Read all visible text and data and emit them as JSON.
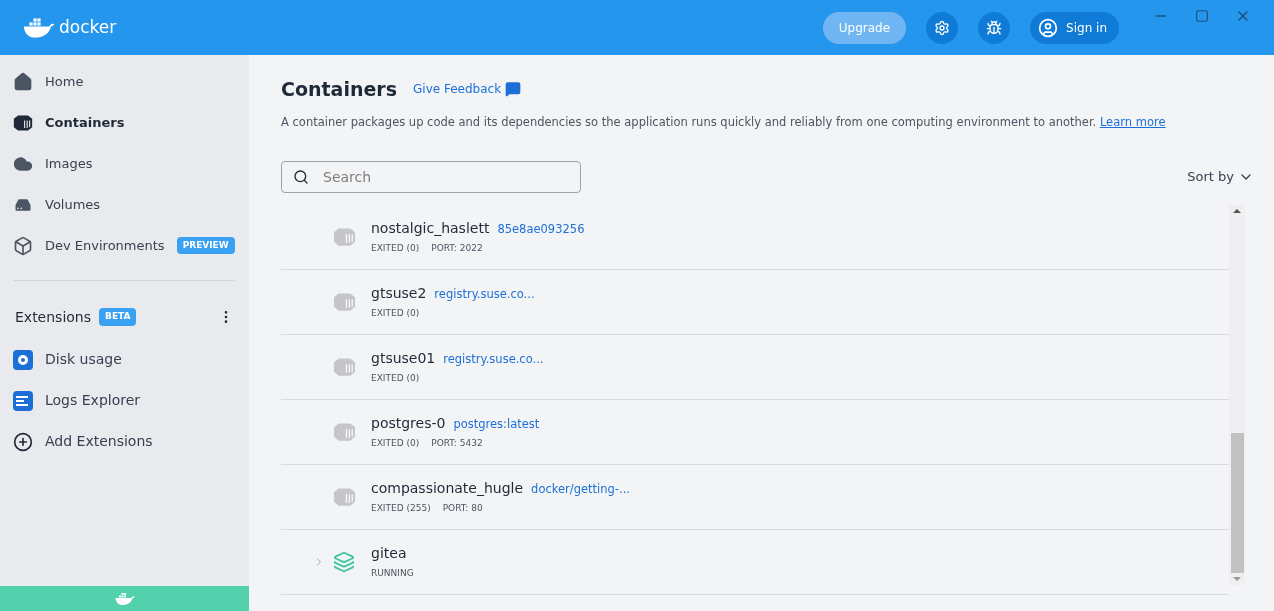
{
  "header": {
    "logo": "docker",
    "upgrade": "Upgrade",
    "sign_in": "Sign in"
  },
  "sidebar": {
    "items": [
      {
        "label": "Home",
        "selected": false
      },
      {
        "label": "Containers",
        "selected": true
      },
      {
        "label": "Images",
        "selected": false
      },
      {
        "label": "Volumes",
        "selected": false
      },
      {
        "label": "Dev Environments",
        "selected": false,
        "badge": "PREVIEW"
      }
    ],
    "extensions": {
      "label": "Extensions",
      "badge": "BETA",
      "items": [
        {
          "label": "Disk usage"
        },
        {
          "label": "Logs Explorer"
        },
        {
          "label": "Add Extensions"
        }
      ]
    }
  },
  "main": {
    "title": "Containers",
    "feedback": "Give Feedback",
    "description": "A container packages up code and its dependencies so the application runs quickly and reliably from one computing environment to another.",
    "learn_more": "Learn more",
    "search": {
      "placeholder": "Search"
    },
    "sort": "Sort by",
    "rows": [
      {
        "kind": "container",
        "name": "nostalgic_haslett",
        "image": "85e8ae093256",
        "status": "EXITED (0)",
        "port": "PORT: 2022"
      },
      {
        "kind": "container",
        "name": "gtsuse2",
        "image": "registry.suse.co...",
        "status": "EXITED (0)"
      },
      {
        "kind": "container",
        "name": "gtsuse01",
        "image": "registry.suse.co...",
        "status": "EXITED (0)"
      },
      {
        "kind": "container",
        "name": "postgres-0",
        "image": "postgres:latest",
        "status": "EXITED (0)",
        "port": "PORT: 5432"
      },
      {
        "kind": "container",
        "name": "compassionate_hugle",
        "image": "docker/getting-...",
        "status": "EXITED (255)",
        "port": "PORT: 80"
      },
      {
        "kind": "compose",
        "name": "gitea",
        "status": "RUNNING",
        "expanded": false
      }
    ]
  }
}
